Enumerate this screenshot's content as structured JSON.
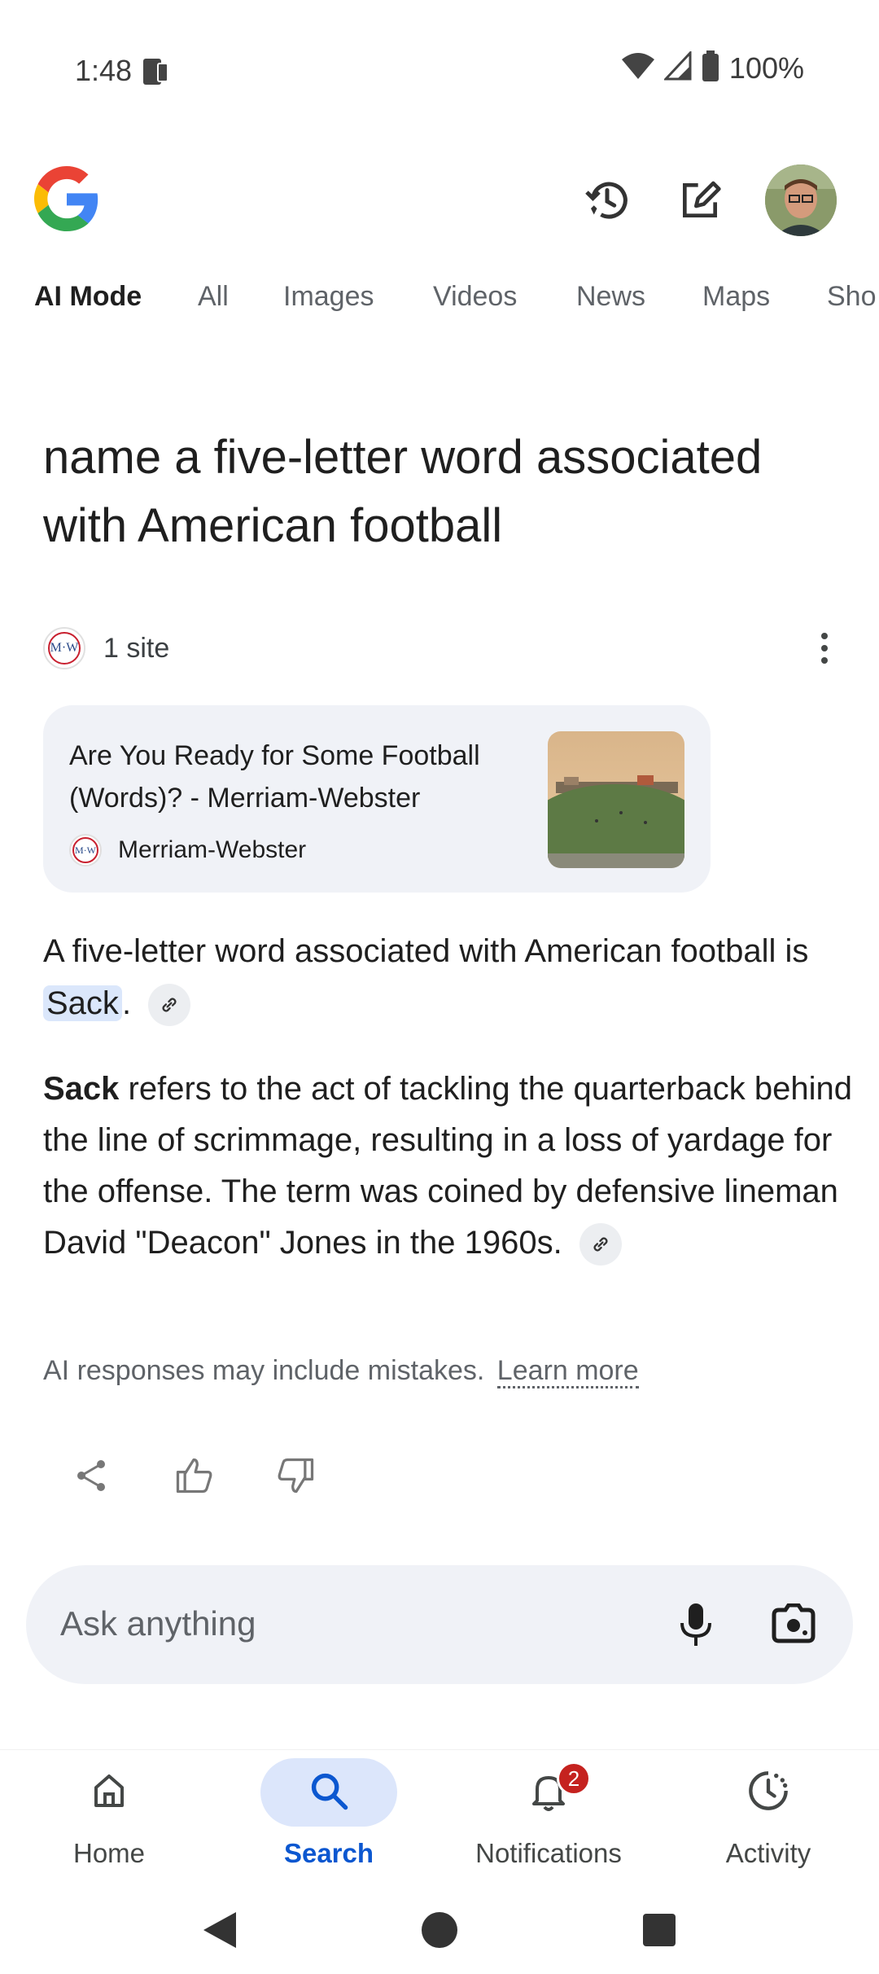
{
  "status_bar": {
    "time": "1:48",
    "battery": "100%"
  },
  "header": {
    "logo": "google-g-logo",
    "icons": [
      "history-icon",
      "edit-icon",
      "avatar"
    ]
  },
  "tabs": [
    {
      "label": "AI Mode",
      "active": true
    },
    {
      "label": "All"
    },
    {
      "label": "Images"
    },
    {
      "label": "Videos"
    },
    {
      "label": "News"
    },
    {
      "label": "Maps"
    },
    {
      "label": "Sho"
    }
  ],
  "query": "name a five-letter word associated with American football",
  "sources": {
    "count_label": "1 site",
    "card": {
      "title": "Are You Ready for Some Football (Words)? - Merriam-Webster",
      "site_name": "Merriam-Webster",
      "logo_text": "M·W"
    }
  },
  "answer": {
    "p1_before": "A five-letter word associated with American football is ",
    "p1_highlight": "Sack",
    "p1_after": ".",
    "p2_bold": "Sack",
    "p2_rest": " refers to the act of tackling the quarterback behind the line of scrimmage, resulting in a loss of yardage for the offense. The term was coined by defensive lineman David \"Deacon\" Jones in the 1960s."
  },
  "disclaimer": {
    "text": "AI responses may include mistakes.",
    "link": "Learn more"
  },
  "ask": {
    "placeholder": "Ask anything"
  },
  "bottom_nav": {
    "home": "Home",
    "search": "Search",
    "notifications": "Notifications",
    "notifications_badge": "2",
    "activity": "Activity"
  },
  "colors": {
    "accent": "#0b57d0",
    "card_bg": "#f0f2f7",
    "highlight": "#dbe7fb",
    "badge": "#c5221f"
  }
}
